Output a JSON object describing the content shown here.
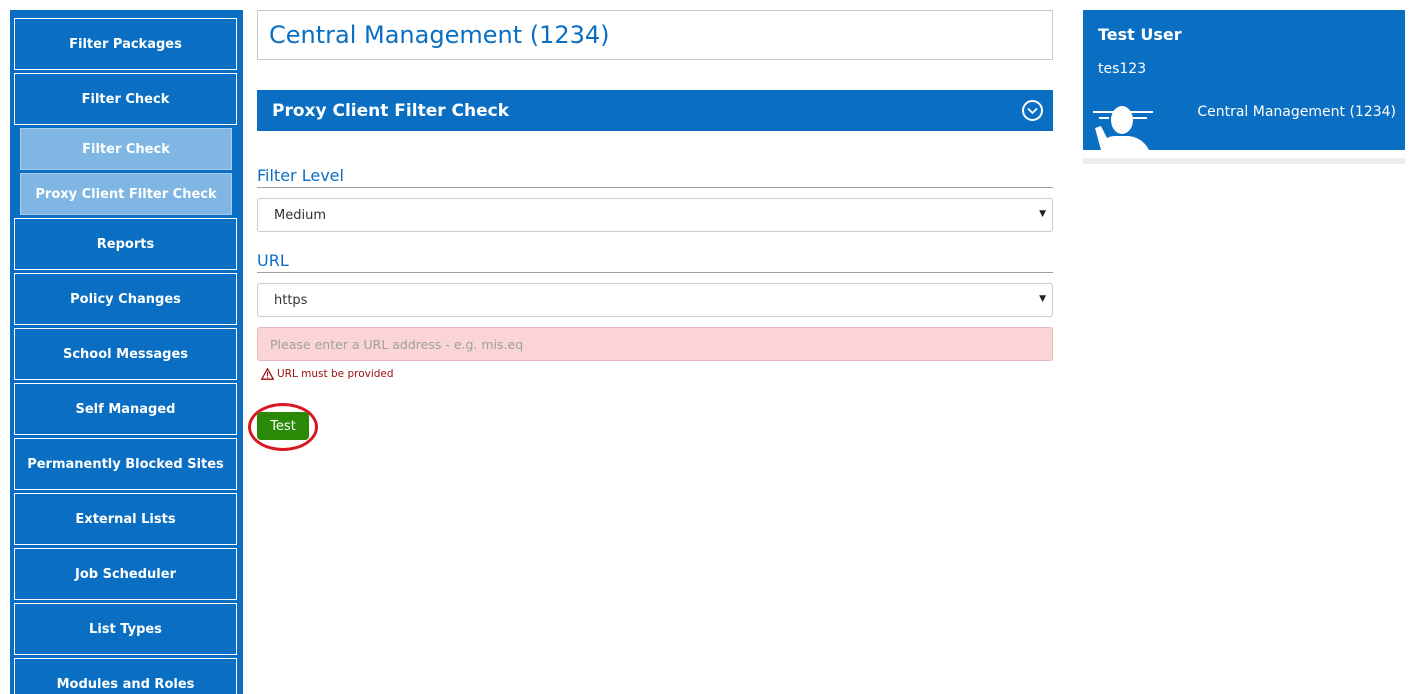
{
  "colors": {
    "primary": "#0a6fc2",
    "submenu": "#7fb6e3",
    "error_bg": "#fad4d6",
    "error_text": "#a01010",
    "test_button": "#2a8a08",
    "highlight_ring": "#d81820"
  },
  "sidebar": {
    "items": [
      {
        "label": "Filter Packages"
      },
      {
        "label": "Filter Check"
      },
      {
        "label": "Filter Check",
        "sub": true
      },
      {
        "label": "Proxy Client Filter Check",
        "sub": true
      },
      {
        "label": "Reports"
      },
      {
        "label": "Policy Changes"
      },
      {
        "label": "School Messages"
      },
      {
        "label": "Self Managed"
      },
      {
        "label": "Permanently Blocked Sites"
      },
      {
        "label": "External Lists"
      },
      {
        "label": "Job Scheduler"
      },
      {
        "label": "List Types"
      },
      {
        "label": "Modules and Roles"
      }
    ]
  },
  "page": {
    "title": "Central Management (1234)"
  },
  "panel": {
    "title": "Proxy Client Filter Check",
    "collapse_icon": "chevron-down-circle-icon"
  },
  "form": {
    "filter_level": {
      "label": "Filter Level",
      "value": "Medium"
    },
    "url": {
      "label": "URL",
      "protocol": "https",
      "placeholder": "Please enter a URL address - e.g. mis.eq",
      "value": "",
      "error": "URL must be provided"
    },
    "test_label": "Test"
  },
  "user": {
    "name": "Test User",
    "id": "tes123",
    "organisation": "Central Management (1234)",
    "avatar_icon": "user-avatar-icon"
  }
}
